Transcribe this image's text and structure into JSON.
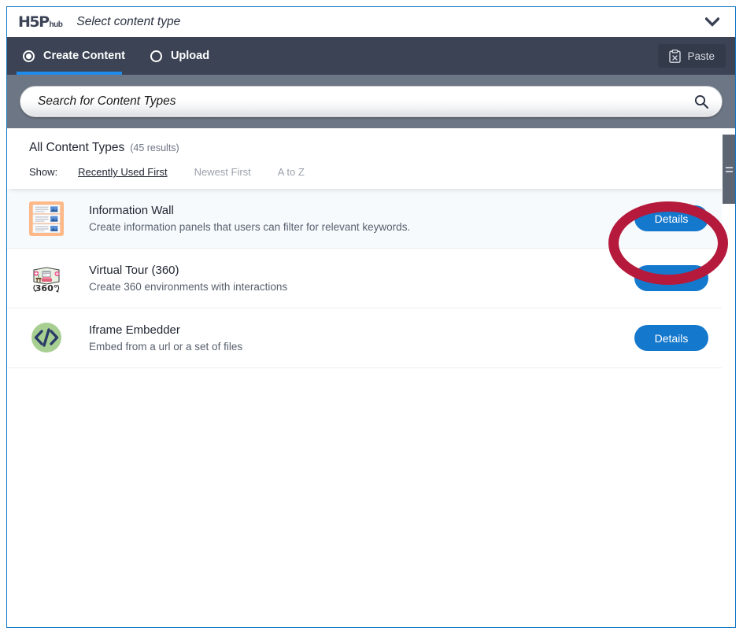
{
  "window": {
    "logo_mark": "H5P",
    "logo_sub": "hub",
    "title": "Select content type",
    "collapse_icon": "chevron-down-icon"
  },
  "navbar": {
    "tabs": [
      {
        "label": "Create Content",
        "selected": true,
        "radio": "radio-selected-icon"
      },
      {
        "label": "Upload",
        "selected": false,
        "radio": "radio-unselected-icon"
      }
    ],
    "paste": {
      "label": "Paste",
      "icon": "clipboard-x-icon"
    },
    "background": "#3b4354",
    "active_underline": "#1f8bea"
  },
  "search": {
    "placeholder": "Search for Content Types",
    "value": "",
    "icon": "search-icon",
    "band_background": "#6d7684"
  },
  "results": {
    "title": "All Content Types",
    "count": "(45 results)",
    "sort_label": "Show:",
    "sort_options": [
      {
        "label": "Recently Used First",
        "active": true
      },
      {
        "label": "Newest First",
        "active": false
      },
      {
        "label": "A to Z",
        "active": false
      }
    ]
  },
  "content_types": [
    {
      "title": "Information Wall",
      "description": "Create information panels that users can filter for relevant keywords.",
      "icon": "information-wall-icon",
      "button": "Details",
      "highlighted": true
    },
    {
      "title": "Virtual Tour (360)",
      "description": "Create 360 environments with interactions",
      "icon": "virtual-tour-360-icon",
      "button": "Details",
      "highlighted": false
    },
    {
      "title": "Iframe Embedder",
      "description": "Embed from a url or a set of files",
      "icon": "iframe-embedder-icon",
      "button": "Details",
      "highlighted": false
    }
  ],
  "scrollbar": {
    "name": "vertical-scrollbar",
    "thumb_color": "#5d6472"
  },
  "annotation": {
    "shape": "ellipse",
    "color": "#b51a3c",
    "target": "details-button-information-wall"
  },
  "colors": {
    "accent_blue": "#1478cd",
    "nav_dark": "#3b4354",
    "search_band": "#6d7684",
    "annotation_red": "#b51a3c"
  }
}
